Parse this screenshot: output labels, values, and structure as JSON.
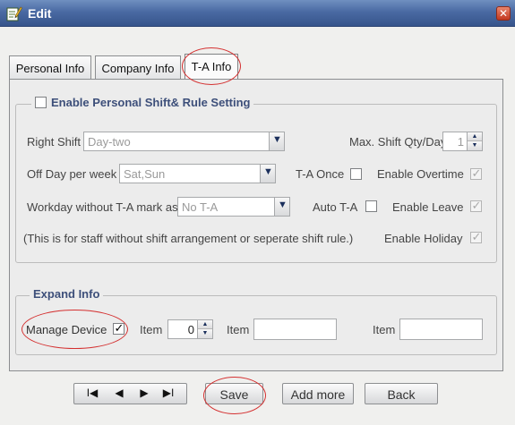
{
  "window": {
    "title": "Edit",
    "close_glyph": "✕"
  },
  "tabs": [
    "Personal Info",
    "Company Info",
    "T-A Info"
  ],
  "shift_group": {
    "legend": "Enable Personal Shift& Rule Setting",
    "right_shift": {
      "label": "Right Shift",
      "value": "Day-two"
    },
    "max_shift": {
      "label": "Max. Shift Qty/Day",
      "value": "1"
    },
    "off_day": {
      "label": "Off Day per week",
      "value": "Sat,Sun"
    },
    "ta_once": {
      "label": "T-A Once"
    },
    "enable_overtime": {
      "label": "Enable Overtime"
    },
    "workday": {
      "label": "Workday without T-A mark as",
      "value": "No T-A"
    },
    "auto_ta": {
      "label": "Auto T-A"
    },
    "enable_leave": {
      "label": "Enable Leave"
    },
    "note": "(This is for staff without shift arrangement or seperate shift rule.)",
    "enable_holiday": {
      "label": "Enable Holiday"
    }
  },
  "expand_group": {
    "legend": "Expand Info",
    "manage_device": {
      "label": "Manage Device",
      "checked": true
    },
    "item1": {
      "label": "Item",
      "value": "0"
    },
    "item2": {
      "label": "Item",
      "value": ""
    },
    "item3": {
      "label": "Item",
      "value": ""
    }
  },
  "nav": {
    "first": "I◀",
    "prev": "◀",
    "next": "▶",
    "last": "▶I"
  },
  "buttons": {
    "save": "Save",
    "add_more": "Add more",
    "back": "Back"
  },
  "colors": {
    "titlebar": "#4a6aa3",
    "legend_text": "#3d4f7a",
    "annotation": "#d43030"
  },
  "icons": [
    "edit-icon",
    "close-icon",
    "dropdown-arrow-icon",
    "spinner-up-icon",
    "spinner-down-icon",
    "checkmark-icon"
  ]
}
